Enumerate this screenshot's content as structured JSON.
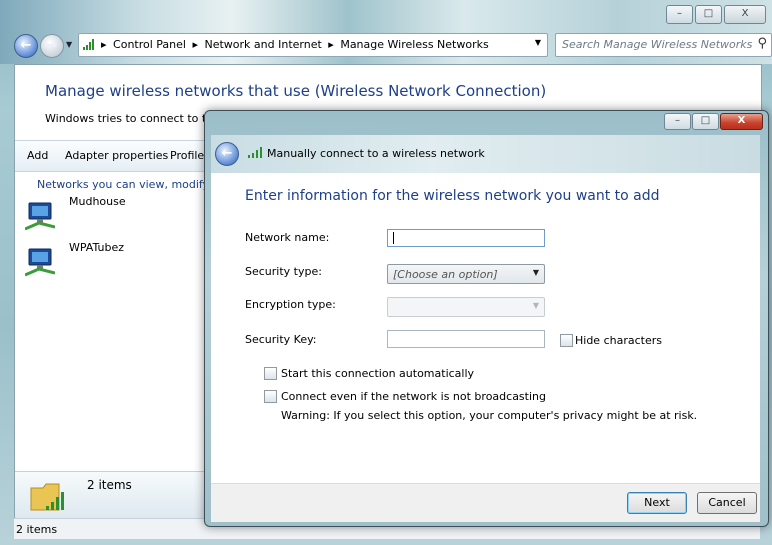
{
  "outer": {
    "window_buttons": [
      "–",
      "□",
      "X"
    ],
    "breadcrumbs": [
      "Control Panel",
      "Network and Internet",
      "Manage Wireless Networks"
    ],
    "search_placeholder": "Search Manage Wireless Networks",
    "title": "Manage wireless networks that use (Wireless Network Connection)",
    "subtitle": "Windows tries to connect to these",
    "toolbar": [
      "Add",
      "Adapter properties",
      "Profile"
    ],
    "list_header": "Networks you can view, modify, and",
    "networks": [
      "Mudhouse",
      "WPATubez"
    ],
    "details_count": "2 items",
    "status_text": "2 items"
  },
  "dialog": {
    "window_buttons": [
      "–",
      "□",
      "X"
    ],
    "title": "Manually connect to a wireless network",
    "heading": "Enter information for the wireless network you want to add",
    "network_name_label": "Network name:",
    "network_name_value": "",
    "security_type_label": "Security type:",
    "security_type_value": "[Choose an option]",
    "encryption_type_label": "Encryption type:",
    "encryption_type_value": "",
    "security_key_label": "Security Key:",
    "security_key_value": "",
    "hide_characters_label": "Hide characters",
    "hide_characters_checked": false,
    "start_auto_label": "Start this connection automatically",
    "start_auto_checked": false,
    "broadcast_label": "Connect even if the network is not broadcasting",
    "broadcast_checked": false,
    "warning": "Warning: If you select this option, your computer's privacy might be at risk.",
    "next_label": "Next",
    "cancel_label": "Cancel"
  },
  "icons": {
    "back": "back-arrow-icon",
    "forward": "forward-arrow-icon",
    "signal": "wireless-signal-icon",
    "search": "search-icon",
    "refresh": "refresh-icon",
    "network": "wireless-network-icon"
  },
  "colors": {
    "heading_blue": "#1e3f8a",
    "close_red": "#c8412a"
  }
}
